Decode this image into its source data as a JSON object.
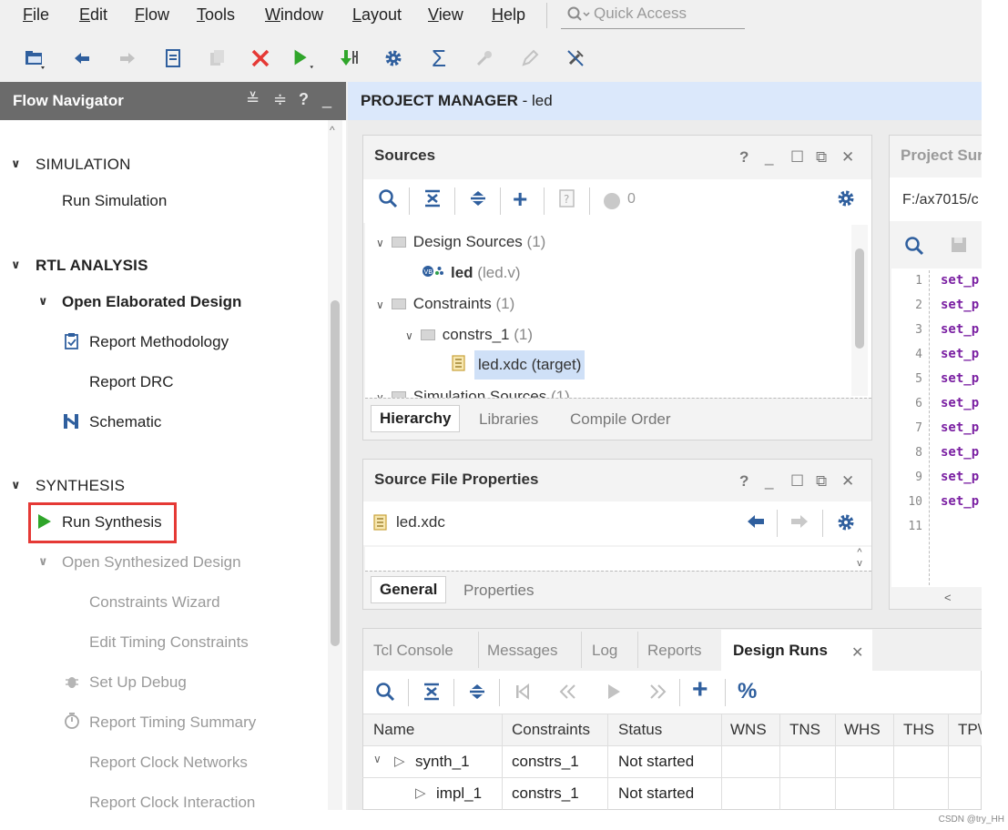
{
  "menubar": {
    "items": [
      {
        "label": "File",
        "underline": "F",
        "rest": "ile"
      },
      {
        "label": "Edit",
        "underline": "E",
        "rest": "dit"
      },
      {
        "label": "Flow",
        "underline": "F",
        "rest": "low"
      },
      {
        "label": "Tools",
        "underline": "T",
        "rest": "ools"
      },
      {
        "label": "Window",
        "underline": "W",
        "rest": "indow"
      },
      {
        "label": "Layout",
        "underline": "L",
        "rest": "ayout"
      },
      {
        "label": "View",
        "underline": "V",
        "rest": "iew"
      },
      {
        "label": "Help",
        "underline": "H",
        "rest": "elp"
      }
    ],
    "quick_access_placeholder": "Quick Access"
  },
  "flow_navigator": {
    "title": "Flow Navigator",
    "simulation": {
      "label": "SIMULATION",
      "run_simulation": "Run Simulation"
    },
    "rtl_analysis": {
      "label": "RTL ANALYSIS",
      "open_elaborated": "Open Elaborated Design",
      "report_methodology": "Report Methodology",
      "report_drc": "Report DRC",
      "schematic": "Schematic"
    },
    "synthesis": {
      "label": "SYNTHESIS",
      "run_synthesis": "Run Synthesis",
      "open_synthesized": "Open Synthesized Design",
      "constraints_wizard": "Constraints Wizard",
      "edit_timing": "Edit Timing Constraints",
      "set_up_debug": "Set Up Debug",
      "report_timing": "Report Timing Summary",
      "report_clock_networks": "Report Clock Networks",
      "report_clock_interaction": "Report Clock Interaction"
    }
  },
  "project_manager": {
    "title_bold": "PROJECT MANAGER",
    "title_rest": " - led"
  },
  "sources": {
    "title": "Sources",
    "badge_count": "0",
    "design_sources": "Design Sources",
    "design_sources_count": "(1)",
    "led_name": "led",
    "led_file": "(led.v)",
    "constraints": "Constraints",
    "constraints_count": "(1)",
    "constrs_1": "constrs_1",
    "constrs_1_count": "(1)",
    "led_xdc": "led.xdc (target)",
    "simulation_sources": "Simulation Sources",
    "simulation_sources_count": "(1)",
    "tabs": [
      "Hierarchy",
      "Libraries",
      "Compile Order"
    ]
  },
  "source_file_properties": {
    "title": "Source File Properties",
    "file": "led.xdc",
    "tabs": [
      "General",
      "Properties"
    ]
  },
  "project_summary": {
    "title": "Project Sur",
    "path": "F:/ax7015/c",
    "line_numbers": [
      "1",
      "2",
      "3",
      "4",
      "5",
      "6",
      "7",
      "8",
      "9",
      "10",
      "11"
    ],
    "code_prefix": "set_p"
  },
  "bottom_panel": {
    "tabs": [
      "Tcl Console",
      "Messages",
      "Log",
      "Reports",
      "Design Runs"
    ],
    "columns": [
      "Name",
      "Constraints",
      "Status",
      "WNS",
      "TNS",
      "WHS",
      "THS",
      "TP\\"
    ],
    "rows": [
      {
        "name": "synth_1",
        "constraints": "constrs_1",
        "status": "Not started"
      },
      {
        "name": "impl_1",
        "constraints": "constrs_1",
        "status": "Not started"
      }
    ]
  },
  "watermark": "CSDN @try_HH",
  "colors": {
    "accent_green": "#2fa52a",
    "highlight_red": "#e53935",
    "pm_header": "#dbe8fb",
    "selection": "#cfe0f7"
  }
}
